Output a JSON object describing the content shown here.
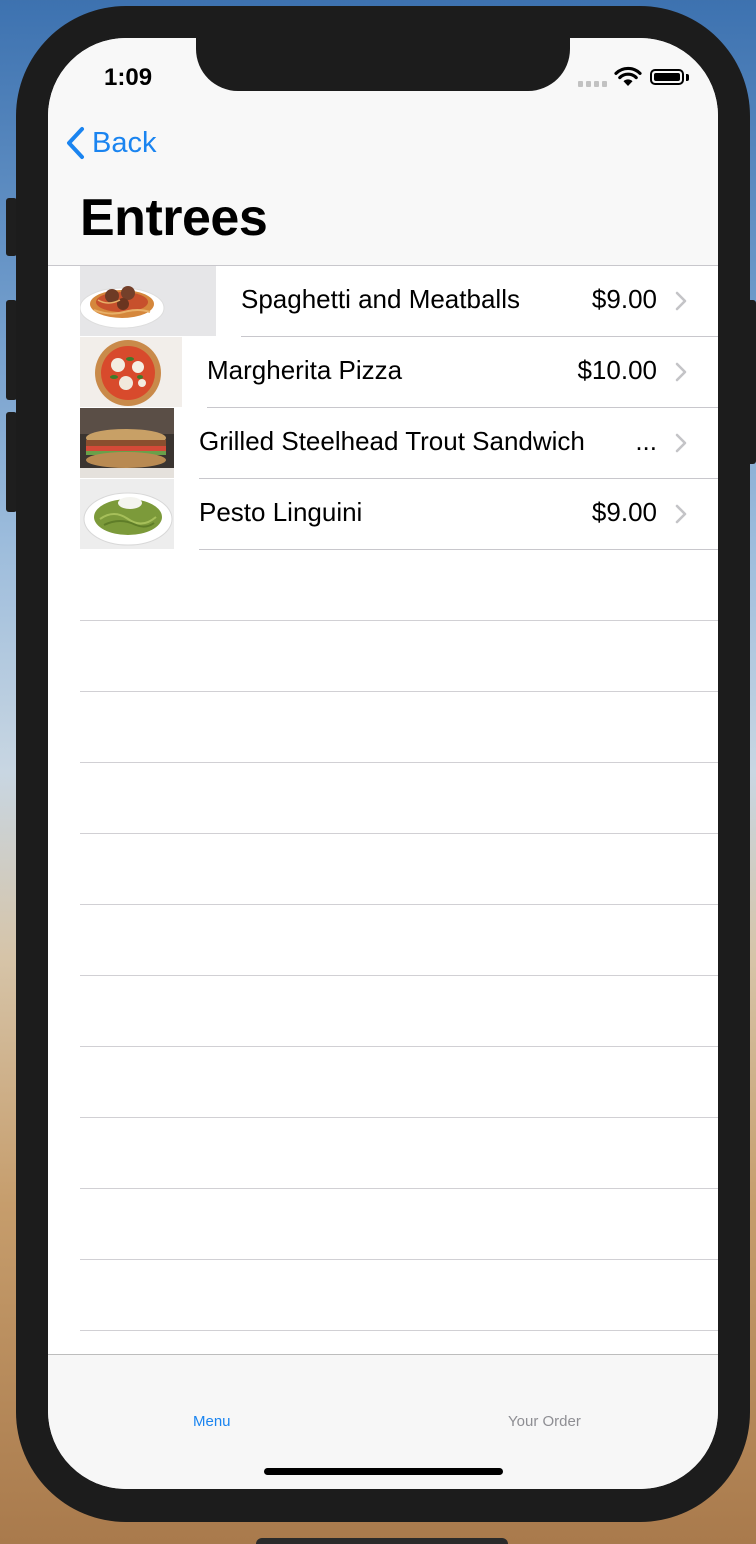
{
  "status_bar": {
    "time": "1:09"
  },
  "nav": {
    "back_label": "Back",
    "title": "Entrees"
  },
  "menu_items": [
    {
      "name": "Spaghetti and Meatballs",
      "price": "$9.00"
    },
    {
      "name": "Margherita Pizza",
      "price": "$10.00"
    },
    {
      "name": "Grilled Steelhead Trout Sandwich",
      "price": "..."
    },
    {
      "name": "Pesto Linguini",
      "price": "$9.00"
    }
  ],
  "tab_bar": {
    "menu_label": "Menu",
    "order_label": "Your Order",
    "active_tab": "Menu"
  },
  "colors": {
    "accent": "#1a84f0",
    "inactive_tab": "#8e8e93",
    "separator": "#c8c7cc"
  },
  "icons": {
    "back": "chevron-left-icon",
    "row_disclosure": "chevron-right-icon",
    "wifi": "wifi-icon",
    "battery": "battery-icon",
    "signal": "cellular-signal-icon"
  }
}
